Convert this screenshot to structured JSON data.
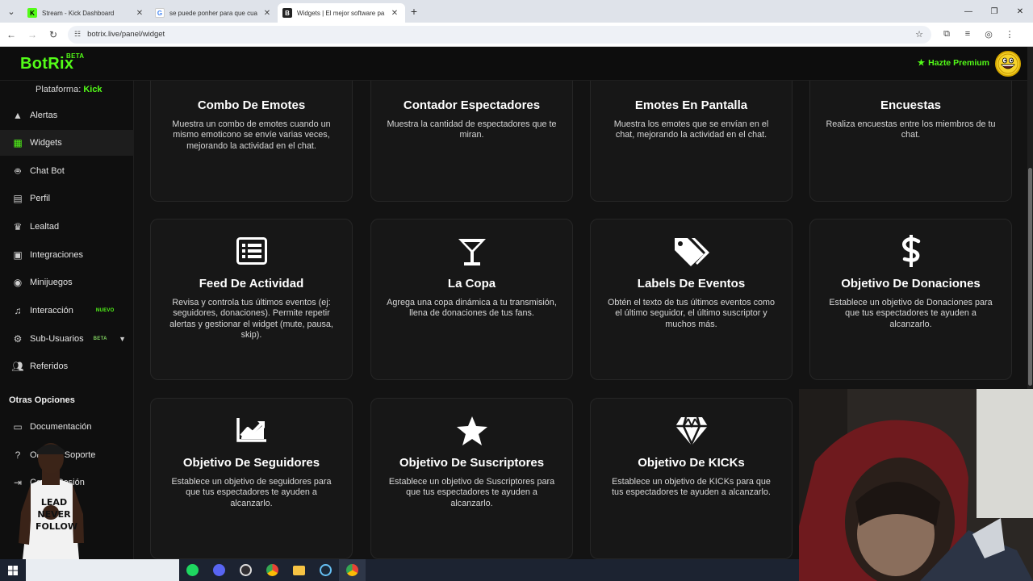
{
  "browser": {
    "tabs": [
      {
        "title": "Stream - Kick Dashboard",
        "favicon": "K",
        "fav_color": "#53fc18",
        "active": false
      },
      {
        "title": "se puede ponher para que cua",
        "favicon": "G",
        "fav_color": "#ffffff",
        "active": false
      },
      {
        "title": "Widgets | El mejor software pa",
        "favicon": "B",
        "fav_color": "#222222",
        "active": true
      }
    ],
    "url": "botrix.live/panel/widget"
  },
  "header": {
    "logo": "BotRix",
    "logo_badge": "BETA",
    "premium_label": "Hazte Premium"
  },
  "sidebar": {
    "platform_label": "Plataforma:",
    "platform_value": "Kick",
    "items": [
      {
        "label": "Alertas",
        "icon": "warning-icon",
        "badge": ""
      },
      {
        "label": "Widgets",
        "icon": "grid-icon",
        "badge": ""
      },
      {
        "label": "Chat Bot",
        "icon": "robot-icon",
        "badge": ""
      },
      {
        "label": "Perfil",
        "icon": "id-card-icon",
        "badge": ""
      },
      {
        "label": "Lealtad",
        "icon": "trophy-icon",
        "badge": ""
      },
      {
        "label": "Integraciones",
        "icon": "plug-icon",
        "badge": ""
      },
      {
        "label": "Minijuegos",
        "icon": "gamepad-icon",
        "badge": ""
      },
      {
        "label": "Interacción",
        "icon": "music-icon",
        "badge": "NUEVO"
      },
      {
        "label": "Sub-Usuarios",
        "icon": "users-cog-icon",
        "badge": "BETA"
      },
      {
        "label": "Referidos",
        "icon": "users-icon",
        "badge": ""
      }
    ],
    "section_title": "Otras Opciones",
    "other_items": [
      {
        "label": "Documentación",
        "icon": "book-icon"
      },
      {
        "label": "Obtener Soporte",
        "icon": "help-icon"
      },
      {
        "label": "Cerrar Sesión",
        "icon": "logout-icon"
      }
    ]
  },
  "widgets": [
    {
      "title": "Combo De Emotes",
      "desc": "Muestra un combo de emotes cuando un mismo emoticono se envíe varias veces, mejorando la actividad en el chat.",
      "icon": "smile-icon"
    },
    {
      "title": "Contador Espectadores",
      "desc": "Muestra la cantidad de espectadores que te miran.",
      "icon": "eye-icon"
    },
    {
      "title": "Emotes En Pantalla",
      "desc": "Muestra los emotes que se envían en el chat, mejorando la actividad en el chat.",
      "icon": "globe-icon"
    },
    {
      "title": "Encuestas",
      "desc": "Realiza encuestas entre los miembros de tu chat.",
      "icon": "poll-icon"
    },
    {
      "title": "Feed De Actividad",
      "desc": "Revisa y controla tus últimos eventos (ej: seguidores, donaciones). Permite repetir alertas y gestionar el widget (mute, pausa, skip).",
      "icon": "list-icon"
    },
    {
      "title": "La Copa",
      "desc": "Agrega una copa dinámica a tu transmisión, llena de donaciones de tus fans.",
      "icon": "cocktail-icon"
    },
    {
      "title": "Labels De Eventos",
      "desc": "Obtén el texto de tus últimos eventos como el último seguidor, el último suscriptor y muchos más.",
      "icon": "tags-icon"
    },
    {
      "title": "Objetivo De Donaciones",
      "desc": "Establece un objetivo de Donaciones para que tus espectadores te ayuden a alcanzarlo.",
      "icon": "dollar-icon"
    },
    {
      "title": "Objetivo De Seguidores",
      "desc": "Establece un objetivo de seguidores para que tus espectadores te ayuden a alcanzarlo.",
      "icon": "chart-icon"
    },
    {
      "title": "Objetivo De Suscriptores",
      "desc": "Establece un objetivo de Suscriptores para que tus espectadores te ayuden a alcanzarlo.",
      "icon": "star-icon"
    },
    {
      "title": "Objetivo De KICKs",
      "desc": "Establece un objetivo de KICKs para que tus espectadores te ayuden a alcanzarlo.",
      "icon": "diamond-icon"
    }
  ],
  "overlay": {
    "shirt_text": "LEAD NEVER FOLLOW"
  },
  "colors": {
    "accent": "#53fc18",
    "card_bg": "#171717",
    "page_bg": "#131313"
  }
}
